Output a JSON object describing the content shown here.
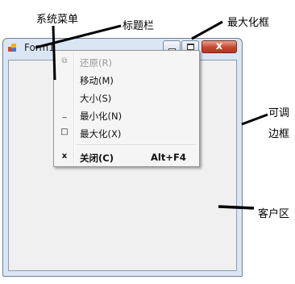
{
  "annotations": {
    "system_menu": "系统菜单",
    "title_bar": "标题栏",
    "maximize_box": "最大化框",
    "resizable_border_line1": "可调",
    "resizable_border_line2": "边框",
    "client_area": "客户区"
  },
  "window": {
    "title": "Form1",
    "close_glyph": "x"
  },
  "system_menu": {
    "items": [
      {
        "label": "还原(R)",
        "icon": "restore-icon",
        "glyph": "⧉",
        "shortcut": "",
        "enabled": false
      },
      {
        "label": "移动(M)",
        "icon": "",
        "glyph": "",
        "shortcut": "",
        "enabled": true
      },
      {
        "label": "大小(S)",
        "icon": "",
        "glyph": "",
        "shortcut": "",
        "enabled": true
      },
      {
        "label": "最小化(N)",
        "icon": "minimize-icon",
        "glyph": "_",
        "shortcut": "",
        "enabled": true
      },
      {
        "label": "最大化(X)",
        "icon": "maximize-icon",
        "glyph": "□",
        "shortcut": "",
        "enabled": true
      },
      {
        "label": "关闭(C)",
        "icon": "close-icon",
        "glyph": "x",
        "shortcut": "Alt+F4",
        "enabled": true
      }
    ]
  },
  "colors": {
    "frame": "#dbe6f4",
    "close_button": "#c7452f",
    "menu_background": "#f5f5f5",
    "arrow": "#000000"
  }
}
